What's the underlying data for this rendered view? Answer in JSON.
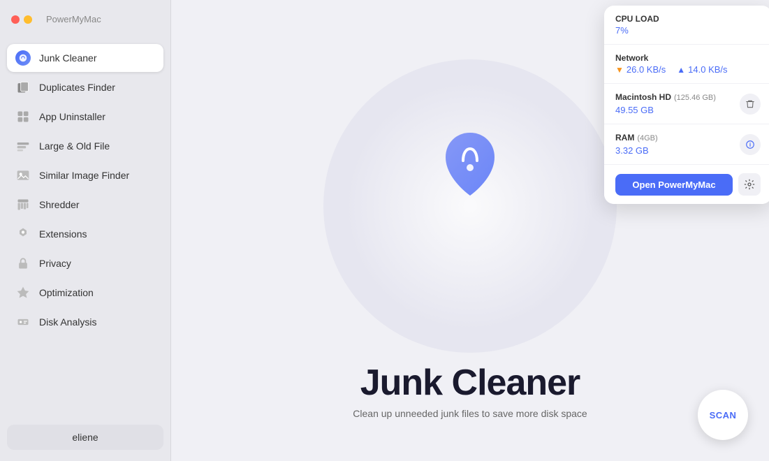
{
  "app": {
    "title": "PowerMyMac",
    "traffic_lights": [
      "red",
      "yellow"
    ]
  },
  "sidebar": {
    "items": [
      {
        "id": "junk-cleaner",
        "label": "Junk Cleaner",
        "icon": "🔵",
        "active": true
      },
      {
        "id": "duplicates-finder",
        "label": "Duplicates Finder",
        "icon": "📁",
        "active": false
      },
      {
        "id": "app-uninstaller",
        "label": "App Uninstaller",
        "icon": "📦",
        "active": false
      },
      {
        "id": "large-old-file",
        "label": "Large & Old File",
        "icon": "🗄️",
        "active": false
      },
      {
        "id": "similar-image-finder",
        "label": "Similar Image Finder",
        "icon": "🖼️",
        "active": false
      },
      {
        "id": "shredder",
        "label": "Shredder",
        "icon": "🗂️",
        "active": false
      },
      {
        "id": "extensions",
        "label": "Extensions",
        "icon": "⚙️",
        "active": false
      },
      {
        "id": "privacy",
        "label": "Privacy",
        "icon": "🔒",
        "active": false
      },
      {
        "id": "optimization",
        "label": "Optimization",
        "icon": "🔮",
        "active": false
      },
      {
        "id": "disk-analysis",
        "label": "Disk Analysis",
        "icon": "💾",
        "active": false
      }
    ],
    "user": "eliene"
  },
  "main": {
    "title": "Junk Cleaner",
    "subtitle": "Clean up unneeded junk files to save more disk space",
    "scan_button": "SCAN"
  },
  "help_button": "?",
  "popup": {
    "cpu": {
      "label": "CPU LOAD",
      "value": "7%"
    },
    "network": {
      "label": "Network",
      "download": "26.0 KB/s",
      "upload": "14.0 KB/s"
    },
    "disk": {
      "label": "Macintosh HD",
      "size": "(125.46 GB)",
      "value": "49.55 GB"
    },
    "ram": {
      "label": "RAM",
      "size": "(4GB)",
      "value": "3.32 GB"
    },
    "open_button": "Open PowerMyMac",
    "settings_icon": "⚙️"
  }
}
